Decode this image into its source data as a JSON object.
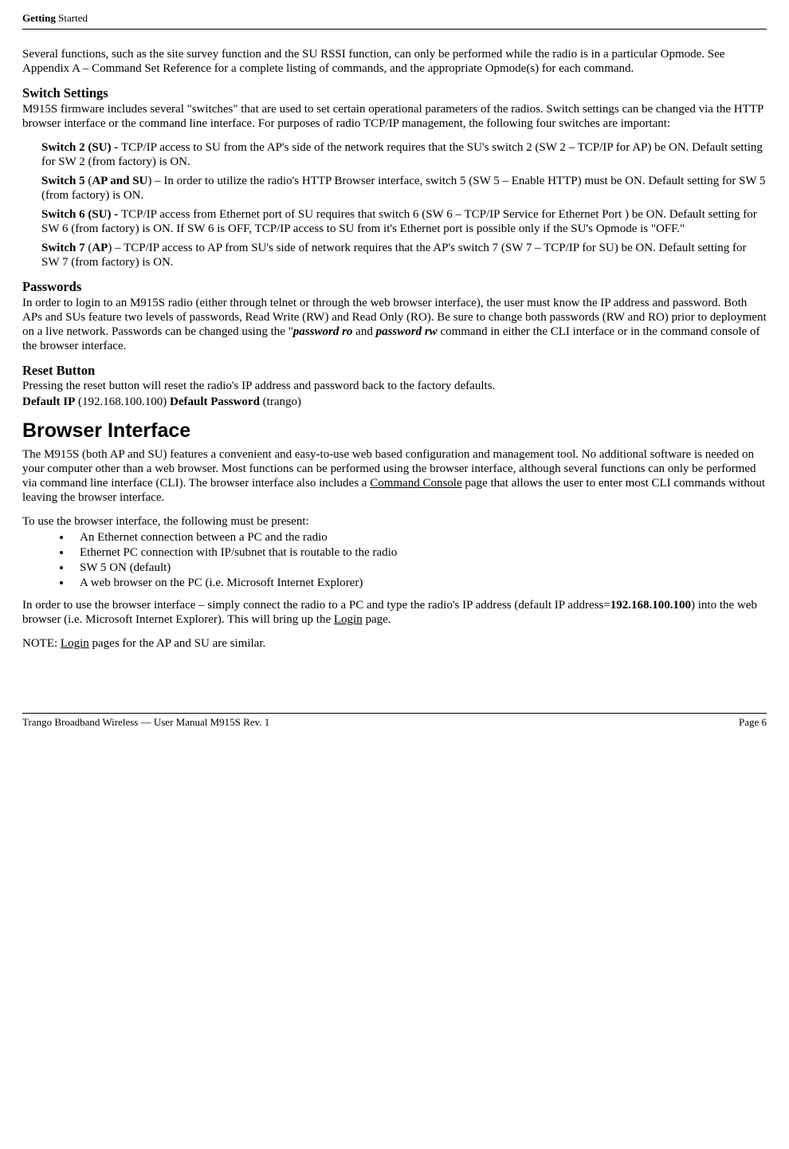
{
  "header": {
    "section_prefix_bold": "Getting",
    "section_suffix": " Started"
  },
  "intro": "Several functions, such as the site survey function and the SU RSSI function, can only be performed while the radio is in a particular Opmode.  See Appendix A – Command Set Reference for a complete listing of commands, and the appropriate Opmode(s) for each command.",
  "switch_settings": {
    "heading": "Switch Settings",
    "intro": "M915S firmware includes several \"switches\" that are used to set certain operational parameters of the radios.  Switch settings can be changed via the HTTP browser interface or the command line interface.  For purposes of radio TCP/IP management, the following four switches are important:",
    "items": [
      {
        "label": "Switch 2 (SU) - ",
        "text": "TCP/IP access to SU from the AP's side of the network requires that the SU's switch 2 (SW 2 – TCP/IP for AP) be ON.  Default setting for SW 2 (from factory) is ON."
      },
      {
        "label_pre": "Switch 5 ",
        "label_paren": "(AP and SU)",
        "text": " – In order to utilize the radio's HTTP Browser interface, switch 5 (SW 5 – Enable HTTP) must be ON.  Default setting for SW 5 (from factory) is ON."
      },
      {
        "label": "Switch 6 (SU) - ",
        "text": "TCP/IP access from Ethernet port of SU requires that switch 6 (SW 6 – TCP/IP Service for Ethernet Port ) be ON.  Default setting for SW 6 (from factory) is ON.  If SW 6 is OFF, TCP/IP access to SU from it's Ethernet port is possible only if the SU's Opmode is \"OFF.\""
      },
      {
        "label_pre": "Switch 7 ",
        "label_paren": "(AP)",
        "text": " – TCP/IP access to AP from SU's side of network requires that the AP's switch 7 (SW 7 – TCP/IP for SU) be ON.  Default setting for SW 7 (from factory) is ON."
      }
    ]
  },
  "passwords": {
    "heading": "Passwords",
    "text_pre": "In order to login to an M915S radio (either through telnet or through the web browser interface), the user must know the IP address and password.  Both APs and SUs feature two levels of passwords, Read Write (RW) and Read Only (RO).  Be sure to change both passwords (RW and RO) prior to deployment on a live network.  Passwords can be changed using the \"",
    "cmd_ro": "password ro",
    "mid": " and ",
    "cmd_rw": "password rw",
    "text_post": " command in either the CLI interface or in the command console of the browser interface."
  },
  "reset": {
    "heading": "Reset Button",
    "line1": "Pressing the reset button will reset the radio's IP address and password back to the factory defaults.",
    "default_ip_label": "Default IP",
    "default_ip_value": " (192.168.100.100) ",
    "default_pw_label": "Default Password",
    "default_pw_value": " (trango)"
  },
  "browser": {
    "heading": "Browser Interface",
    "p1_pre": "The M915S (both AP and SU) features a convenient and easy-to-use web based configuration and management tool.  No additional software is needed on your computer other than a web browser.  Most functions can be performed using the browser interface, although several functions can only be performed via command line interface (CLI).  The browser interface also includes a ",
    "p1_u": "Command Console",
    "p1_post": " page that allows the user to enter most CLI commands without leaving the browser interface.",
    "reqs_intro": "To use the browser interface, the following must be present:",
    "bullets": [
      "An Ethernet connection between a PC and the radio",
      "Ethernet PC connection with IP/subnet that is routable to the radio",
      "SW 5 ON (default)",
      "A web browser on the PC (i.e. Microsoft Internet Explorer)"
    ],
    "p2_pre": "In order to use the browser interface – simply connect the radio to a PC and type the radio's IP address (default IP address=",
    "p2_ip": "192.168.100.100",
    "p2_mid": ") into the web browser (i.e. Microsoft Internet Explorer).  This will bring up the ",
    "p2_u": "Login",
    "p2_post": " page.",
    "note_pre": "NOTE:  ",
    "note_u": "Login",
    "note_post": " pages for the AP and SU are similar."
  },
  "footer": {
    "left": "Trango Broadband Wireless — User Manual M915S Rev. 1",
    "right": "Page 6"
  }
}
